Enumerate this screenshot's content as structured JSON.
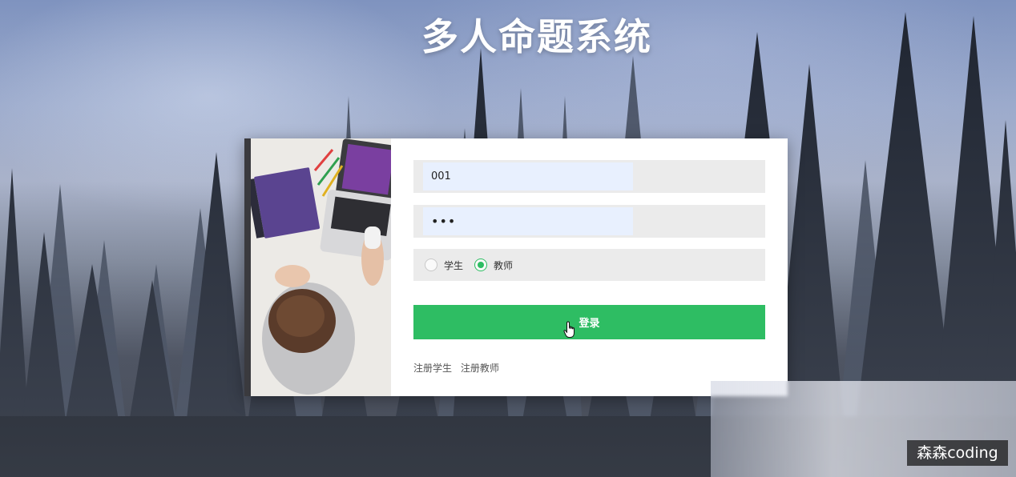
{
  "page": {
    "title": "多人命题系统"
  },
  "login_form": {
    "username": {
      "value": "001",
      "placeholder": ""
    },
    "password": {
      "value": "123",
      "placeholder": ""
    },
    "role": {
      "options": [
        {
          "label": "学生",
          "selected": false
        },
        {
          "label": "教师",
          "selected": true
        }
      ]
    },
    "submit_label": "登录",
    "links": {
      "register_student": "注册学生",
      "register_teacher": "注册教师"
    }
  },
  "watermark": {
    "text": "森森coding"
  },
  "theme": {
    "accent": "#2ebd63",
    "field_bg": "#ebebeb",
    "autofill_bg": "#e8f0fe"
  },
  "icons": {
    "cursor": "hand-pointer-icon"
  }
}
